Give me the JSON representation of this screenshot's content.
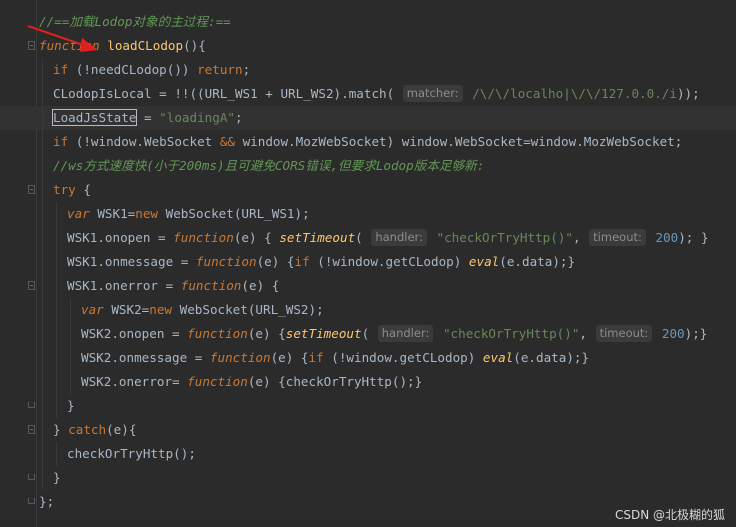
{
  "theme": {
    "kw": "#cc7832",
    "fn": "#ffc66d",
    "str": "#6a8759",
    "num": "#6897bb",
    "cmt": "#629755",
    "var": "#9876aa",
    "plain": "#a9b7c6",
    "call": "#a9b7c6",
    "italic": "#ffc66d",
    "bg": "#2b2b2b",
    "annotation_arrow": "#e02020"
  },
  "watermark": "CSDN @北极糊的狐",
  "lines": [
    {
      "indent": 0,
      "fold": null,
      "tokens": [
        [
          "cmt",
          "//==加载Lodop对象的主过程:=="
        ]
      ]
    },
    {
      "indent": 0,
      "fold": "open",
      "tokens": [
        [
          "kw-i",
          "function "
        ],
        [
          "fn",
          "loadCLodop"
        ],
        [
          "plain",
          "(){"
        ]
      ]
    },
    {
      "indent": 1,
      "fold": null,
      "tokens": [
        [
          "kw",
          "if "
        ],
        [
          "plain",
          "(!needCLodop()) "
        ],
        [
          "kw",
          "return"
        ],
        [
          "plain",
          ";"
        ]
      ]
    },
    {
      "indent": 1,
      "fold": null,
      "tokens": [
        [
          "plain",
          "CLodopIsLocal = !!((URL_WS1 + URL_WS2).match( "
        ],
        [
          "hint",
          "matcher:"
        ],
        [
          "str",
          " /\\/\\/localho|\\/\\/127.0.0./i"
        ],
        [
          "plain",
          "));"
        ]
      ]
    },
    {
      "indent": 1,
      "fold": null,
      "current": true,
      "tokens": [
        [
          "box",
          "LoadJsState"
        ],
        [
          "plain",
          " = "
        ],
        [
          "str",
          "\"loadingA\""
        ],
        [
          "plain",
          ";"
        ]
      ]
    },
    {
      "indent": 1,
      "fold": null,
      "tokens": [
        [
          "kw",
          "if "
        ],
        [
          "plain",
          "(!window.WebSocket "
        ],
        [
          "kw",
          "&&"
        ],
        [
          "plain",
          " window.MozWebSocket) window.WebSocket=window.MozWebSocket;"
        ]
      ]
    },
    {
      "indent": 1,
      "fold": null,
      "tokens": [
        [
          "cmt",
          "//ws方式速度快(小于200ms)且可避免CORS错误,但要求Lodop版本足够新:"
        ]
      ]
    },
    {
      "indent": 1,
      "fold": "open",
      "tokens": [
        [
          "kw",
          "try "
        ],
        [
          "plain",
          "{"
        ]
      ]
    },
    {
      "indent": 2,
      "fold": null,
      "tokens": [
        [
          "kw-i",
          "var "
        ],
        [
          "plain",
          "WSK1="
        ],
        [
          "kw",
          "new "
        ],
        [
          "plain",
          "WebSocket(URL_WS1);"
        ]
      ]
    },
    {
      "indent": 2,
      "fold": null,
      "tokens": [
        [
          "plain",
          "WSK1.onopen = "
        ],
        [
          "kw-i",
          "function"
        ],
        [
          "plain",
          "(e) { "
        ],
        [
          "italic",
          "setTimeout"
        ],
        [
          "plain",
          "( "
        ],
        [
          "hint",
          "handler:"
        ],
        [
          "str",
          " \"checkOrTryHttp()\""
        ],
        [
          "plain",
          ", "
        ],
        [
          "hint",
          "timeout:"
        ],
        [
          "num",
          " 200"
        ],
        [
          "plain",
          "); }"
        ]
      ]
    },
    {
      "indent": 2,
      "fold": null,
      "tokens": [
        [
          "plain",
          "WSK1.onmessage = "
        ],
        [
          "kw-i",
          "function"
        ],
        [
          "plain",
          "(e) {"
        ],
        [
          "kw",
          "if "
        ],
        [
          "plain",
          "(!window.getCLodop) "
        ],
        [
          "italic",
          "eval"
        ],
        [
          "plain",
          "(e.data);}"
        ]
      ]
    },
    {
      "indent": 2,
      "fold": "open",
      "tokens": [
        [
          "plain",
          "WSK1.onerror = "
        ],
        [
          "kw-i",
          "function"
        ],
        [
          "plain",
          "(e) {"
        ]
      ]
    },
    {
      "indent": 3,
      "fold": null,
      "tokens": [
        [
          "kw-i",
          "var "
        ],
        [
          "plain",
          "WSK2="
        ],
        [
          "kw",
          "new "
        ],
        [
          "plain",
          "WebSocket(URL_WS2);"
        ]
      ]
    },
    {
      "indent": 3,
      "fold": null,
      "tokens": [
        [
          "plain",
          "WSK2.onopen = "
        ],
        [
          "kw-i",
          "function"
        ],
        [
          "plain",
          "(e) {"
        ],
        [
          "italic",
          "setTimeout"
        ],
        [
          "plain",
          "( "
        ],
        [
          "hint",
          "handler:"
        ],
        [
          "str",
          " \"checkOrTryHttp()\""
        ],
        [
          "plain",
          ", "
        ],
        [
          "hint",
          "timeout:"
        ],
        [
          "num",
          " 200"
        ],
        [
          "plain",
          ");}"
        ]
      ]
    },
    {
      "indent": 3,
      "fold": null,
      "tokens": [
        [
          "plain",
          "WSK2.onmessage = "
        ],
        [
          "kw-i",
          "function"
        ],
        [
          "plain",
          "(e) {"
        ],
        [
          "kw",
          "if "
        ],
        [
          "plain",
          "(!window.getCLodop) "
        ],
        [
          "italic",
          "eval"
        ],
        [
          "plain",
          "(e.data);}"
        ]
      ]
    },
    {
      "indent": 3,
      "fold": null,
      "tokens": [
        [
          "plain",
          "WSK2.onerror= "
        ],
        [
          "kw-i",
          "function"
        ],
        [
          "plain",
          "(e) {checkOrTryHttp();}"
        ]
      ]
    },
    {
      "indent": 2,
      "fold": "close",
      "tokens": [
        [
          "plain",
          "}"
        ]
      ]
    },
    {
      "indent": 1,
      "fold": "open",
      "tokens": [
        [
          "plain",
          "} "
        ],
        [
          "kw",
          "catch"
        ],
        [
          "plain",
          "(e){"
        ]
      ]
    },
    {
      "indent": 2,
      "fold": null,
      "tokens": [
        [
          "plain",
          "checkOrTryHttp();"
        ]
      ]
    },
    {
      "indent": 1,
      "fold": "close",
      "tokens": [
        [
          "plain",
          "}"
        ]
      ]
    },
    {
      "indent": 0,
      "fold": "close",
      "tokens": [
        [
          "plain",
          "};"
        ]
      ]
    }
  ]
}
